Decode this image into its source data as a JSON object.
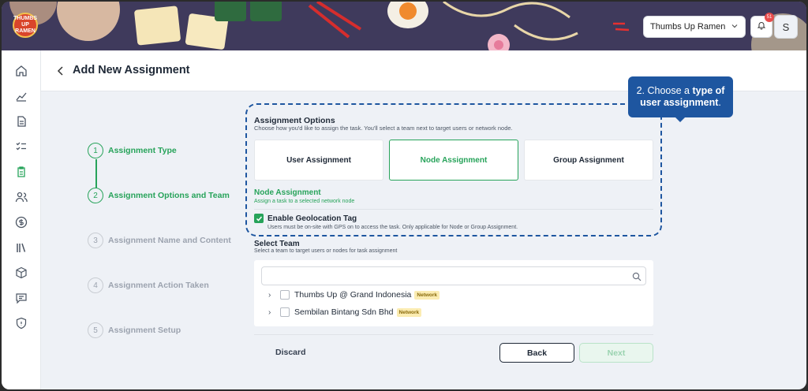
{
  "header": {
    "logo_text": "THUMBS UP RAMEN",
    "restaurant_select": "Thumbs Up Ramen",
    "notification_count": "51",
    "avatar_initial": "S"
  },
  "page": {
    "title": "Add New Assignment"
  },
  "steps": [
    {
      "num": "1",
      "label": "Assignment Type"
    },
    {
      "num": "2",
      "label": "Assignment Options and Team"
    },
    {
      "num": "3",
      "label": "Assignment Name and Content"
    },
    {
      "num": "4",
      "label": "Assignment Action Taken"
    },
    {
      "num": "5",
      "label": "Assignment Setup"
    }
  ],
  "assignment_options": {
    "title": "Assignment Options",
    "subtitle": "Choose how you'd like to assign the task. You'll select a team next to target users or network node.",
    "cards": [
      "User Assignment",
      "Node Assignment",
      "Group Assignment"
    ],
    "selected": "Node Assignment",
    "node_title": "Node Assignment",
    "node_subtitle": "Assign a task to a selected network node",
    "geo_label": "Enable Geolocation Tag",
    "geo_subtitle": "Users must be on-site with GPS on to access the task. Only applicable for Node or Group Assignment.",
    "geo_checked": true
  },
  "tooltip": {
    "prefix": "2. Choose a ",
    "bold": "type of user assignment",
    "suffix": "."
  },
  "select_team": {
    "title": "Select Team",
    "subtitle": "Select a team to target users or nodes for task assignment",
    "search_value": "",
    "teams": [
      {
        "name": "Thumbs Up @ Grand Indonesia",
        "tag": "Network"
      },
      {
        "name": "Sembilan Bintang Sdn Bhd",
        "tag": "Network"
      }
    ]
  },
  "footer": {
    "discard": "Discard",
    "back": "Back",
    "next": "Next"
  },
  "colors": {
    "accent": "#27a35a",
    "tooltip": "#1e56a0",
    "tag_bg": "#fbecb2"
  }
}
